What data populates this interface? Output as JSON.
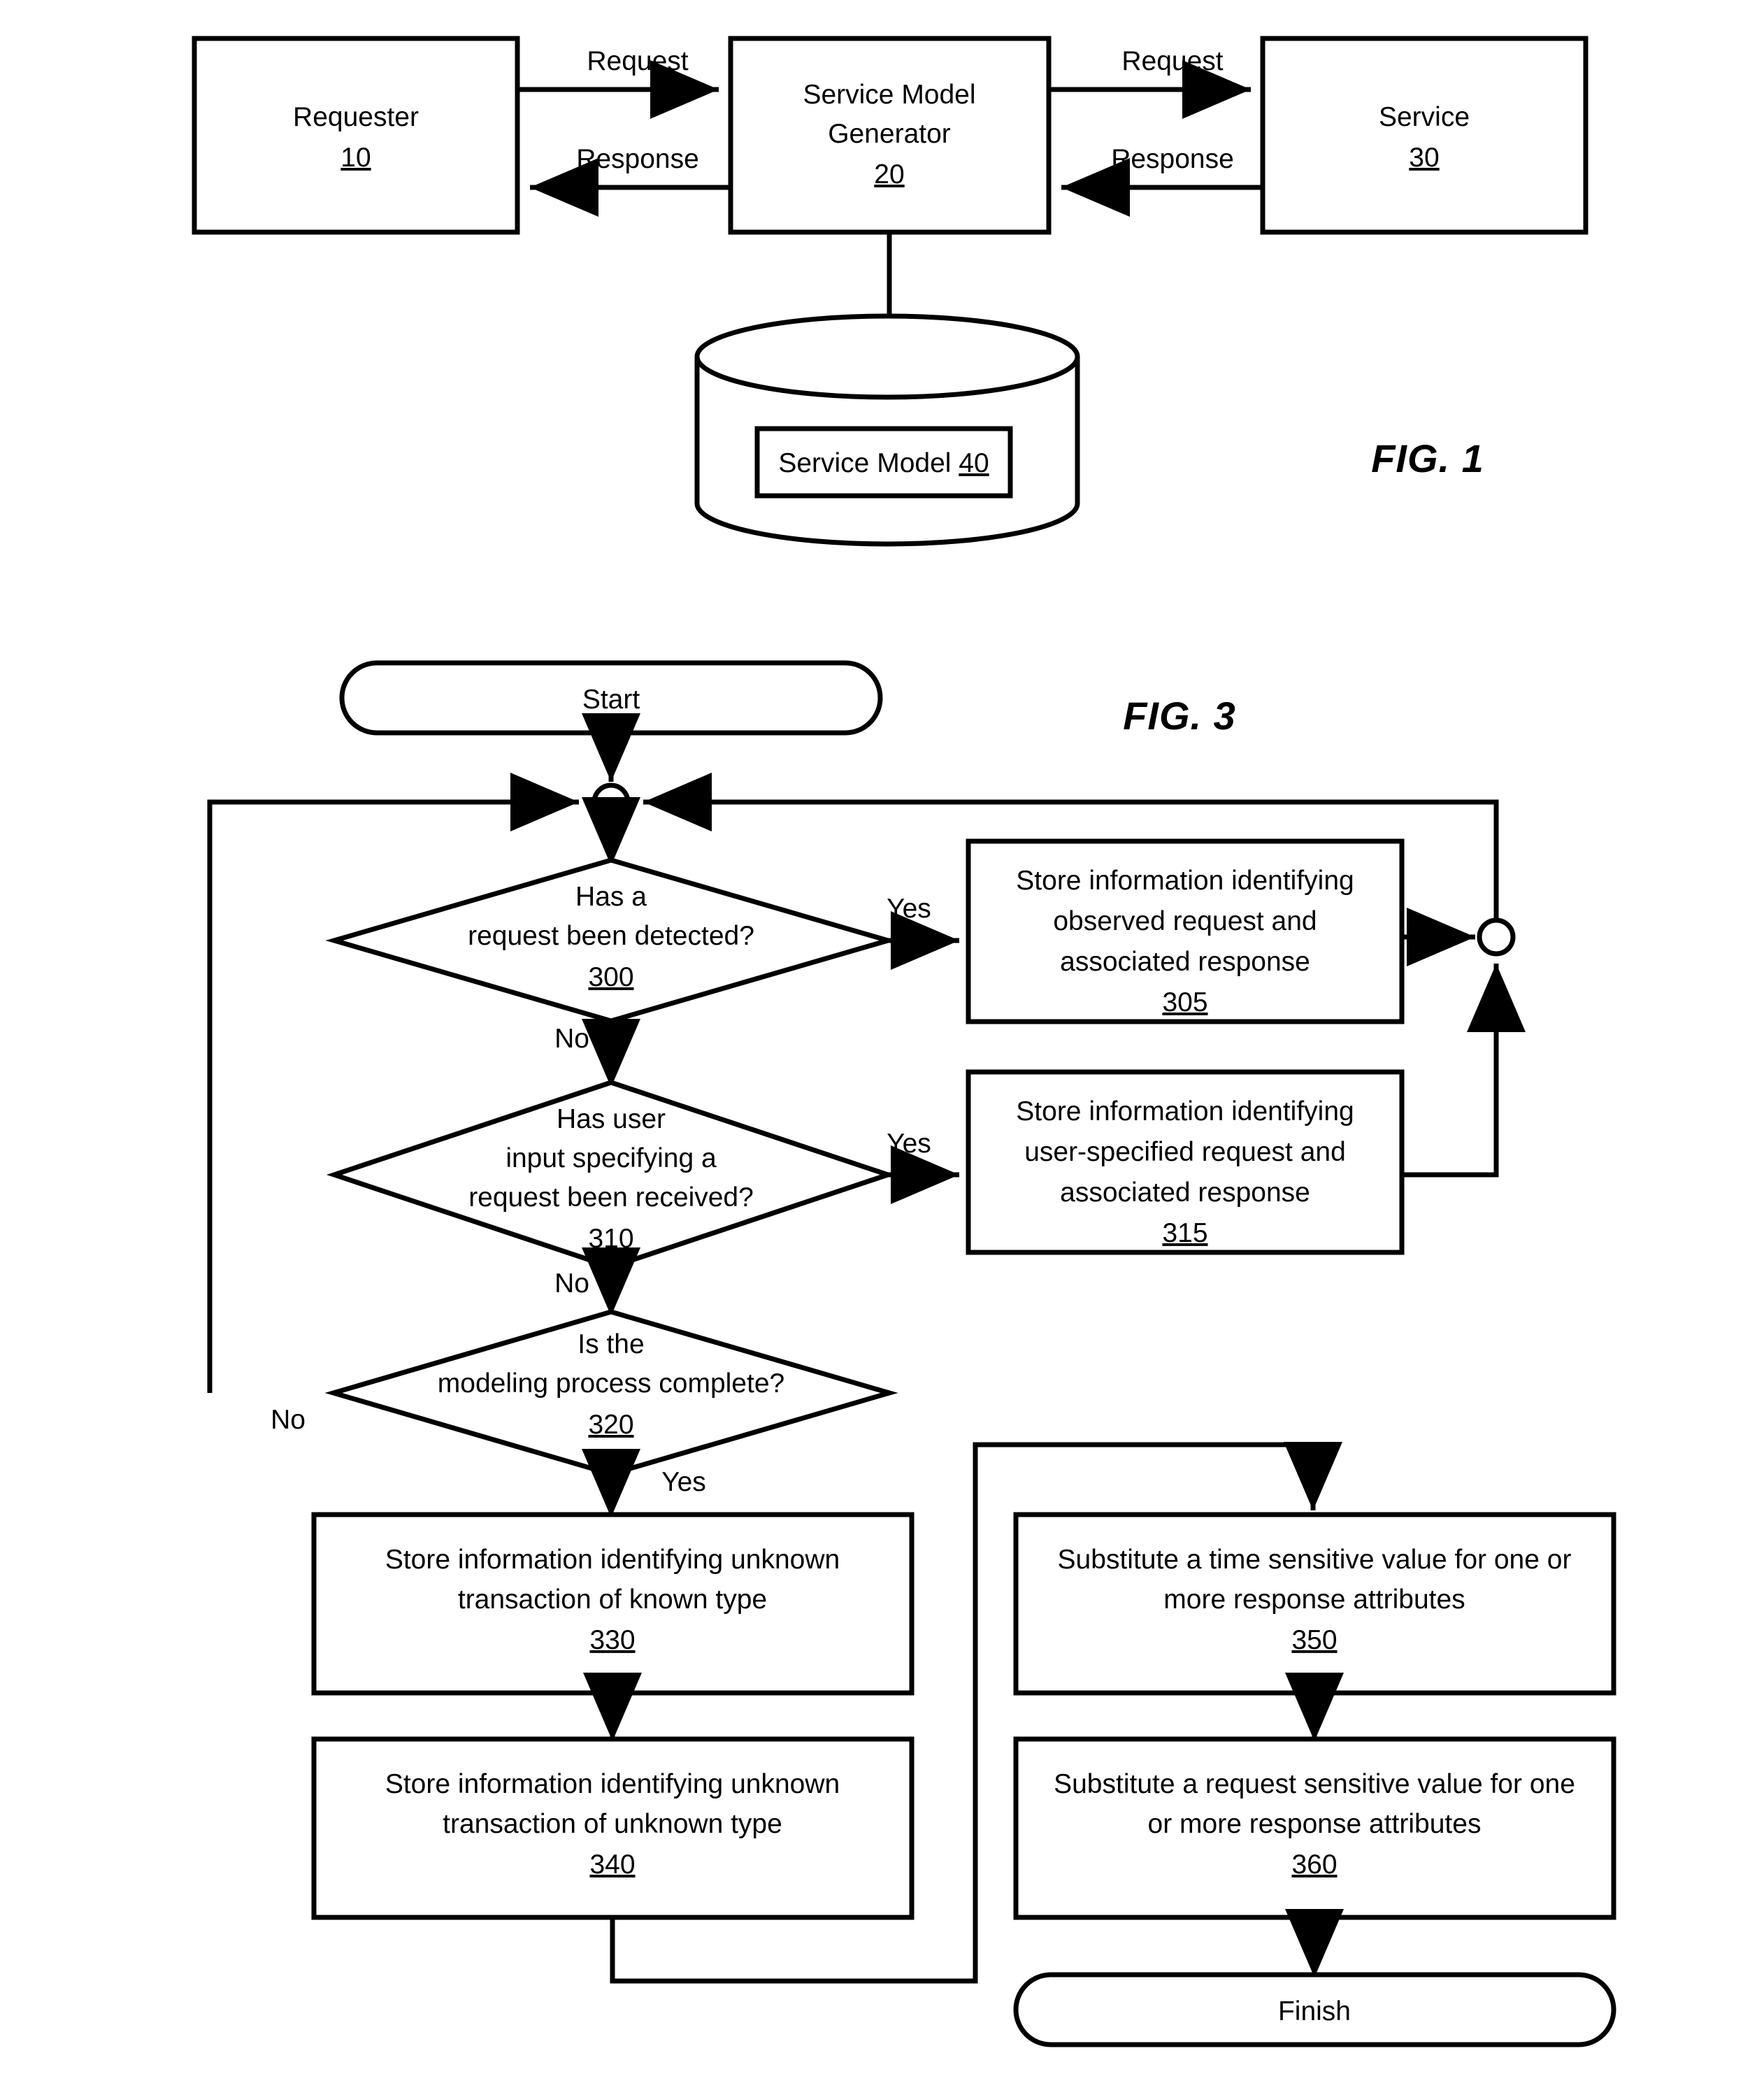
{
  "figures": [
    {
      "id": "fig1",
      "label": "FIG. 1",
      "nodes": {
        "requester": {
          "title": "Requester",
          "ref": "10"
        },
        "generator": {
          "title_line1": "Service Model",
          "title_line2": "Generator",
          "ref": "20"
        },
        "service": {
          "title": "Service",
          "ref": "30"
        },
        "datastore": {
          "title": "Service Model ",
          "ref": "40"
        }
      },
      "edges": {
        "req_to_gen": "Request",
        "gen_to_req": "Response",
        "gen_to_svc": "Request",
        "svc_to_gen": "Response"
      }
    },
    {
      "id": "fig3",
      "label": "FIG. 3",
      "terminals": {
        "start": "Start",
        "finish": "Finish"
      },
      "decisions": [
        {
          "key": "d300",
          "lines": [
            "Has a",
            "request been detected?"
          ],
          "ref": "300",
          "yes_label": "Yes",
          "no_label": "No"
        },
        {
          "key": "d310",
          "lines": [
            "Has user",
            "input specifying a",
            "request been received?"
          ],
          "ref": "310",
          "yes_label": "Yes",
          "no_label": "No"
        },
        {
          "key": "d320",
          "lines": [
            "Is the",
            "modeling process complete?"
          ],
          "ref": "320",
          "yes_label": "Yes",
          "no_label": "No"
        }
      ],
      "processes": [
        {
          "key": "p305",
          "lines": [
            "Store information identifying",
            "observed request and",
            "associated response"
          ],
          "ref": "305"
        },
        {
          "key": "p315",
          "lines": [
            "Store information identifying",
            "user-specified request and",
            "associated response"
          ],
          "ref": "315"
        },
        {
          "key": "p330",
          "lines": [
            "Store information identifying unknown",
            "transaction of known type"
          ],
          "ref": "330"
        },
        {
          "key": "p340",
          "lines": [
            "Store information identifying unknown",
            "transaction of unknown type"
          ],
          "ref": "340"
        },
        {
          "key": "p350",
          "lines": [
            "Substitute a time sensitive value for one or",
            "more response attributes"
          ],
          "ref": "350"
        },
        {
          "key": "p360",
          "lines": [
            "Substitute a request sensitive value for one",
            "or more response attributes"
          ],
          "ref": "360"
        }
      ]
    }
  ]
}
